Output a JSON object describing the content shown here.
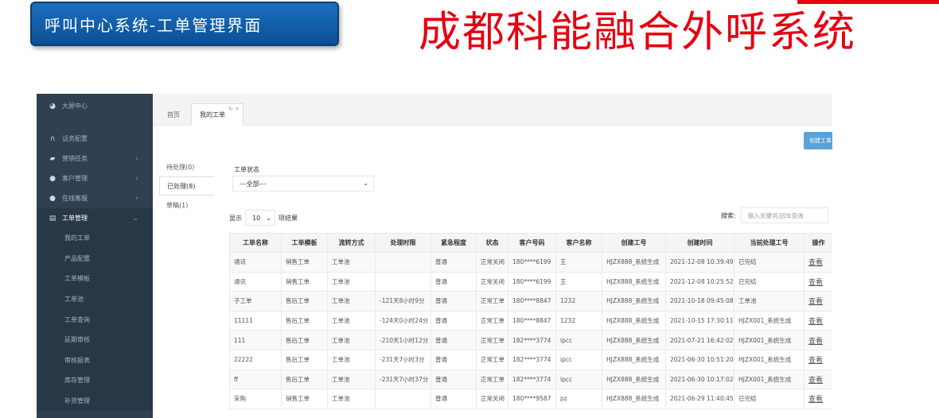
{
  "banner": {
    "left_title": "呼叫中心系统-工单管理界面",
    "brand_title": "成都科能融合外呼系统"
  },
  "sidebar": {
    "items": [
      {
        "icon": "pie-chart-icon",
        "label": "大屏中心",
        "has_arrow": false
      },
      {
        "icon": "headset-icon",
        "label": "话务配置",
        "has_arrow": false
      },
      {
        "icon": "briefcase-icon",
        "label": "营销任务",
        "has_arrow": true
      },
      {
        "icon": "user-icon",
        "label": "客户管理",
        "has_arrow": true
      },
      {
        "icon": "circle-icon",
        "label": "在线客服",
        "has_arrow": true
      },
      {
        "icon": "document-icon",
        "label": "工单管理",
        "has_arrow": true
      }
    ],
    "sub_items": [
      "我的工单",
      "产品配置",
      "工单模板",
      "工单池",
      "工单查询",
      "延期审核",
      "审核报表",
      "库存管理",
      "补货管理"
    ]
  },
  "tabs": {
    "home": "首页",
    "active": "我的工单"
  },
  "toolbar": {
    "create_label": "创建工单"
  },
  "left_nav": {
    "items": [
      "待处理(0)",
      "已处理(8)",
      "草稿(1)"
    ]
  },
  "filter": {
    "label": "工单状态",
    "value": "---全部---"
  },
  "paging": {
    "show_label": "显示",
    "page_size": "10",
    "suffix": "项结果"
  },
  "search": {
    "label": "搜索:",
    "placeholder": "输入关键词,回车查询"
  },
  "table": {
    "headers": [
      "工单名称",
      "工单模板",
      "流转方式",
      "处理时限",
      "紧急程度",
      "状态",
      "客户号码",
      "客户名称",
      "创建工号",
      "创建时间",
      "当前处理工号",
      "操作"
    ],
    "rows": [
      [
        "通讯",
        "销售工单",
        "工单池",
        "",
        "普通",
        "正常关闭",
        "180****6199",
        "王",
        "HJZX888_系统生成",
        "2021-12-08 10:39:49",
        "已完结",
        "查看"
      ],
      [
        "通讯",
        "销售工单",
        "工单池",
        "",
        "普通",
        "正常关闭",
        "180****6199",
        "王",
        "HJZX888_系统生成",
        "2021-12-08 10:25:52",
        "已完结",
        "查看"
      ],
      [
        "子工单",
        "售后工单",
        "工单池",
        "-121天8小时9分",
        "普通",
        "正常工单",
        "180****8847",
        "1232",
        "HJZX888_系统生成",
        "2021-10-18 09:45:08",
        "工单池",
        "查看"
      ],
      [
        "11111",
        "售后工单",
        "工单池",
        "-124天0小时24分",
        "普通",
        "正常工单",
        "180****8847",
        "1232",
        "HJZX888_系统生成",
        "2021-10-15 17:30:11",
        "HJZX001_系统生成",
        "查看"
      ],
      [
        "111",
        "售后工单",
        "工单池",
        "-210天1小时12分",
        "普通",
        "正常工单",
        "182****3774",
        "ipcc",
        "HJZX888_系统生成",
        "2021-07-21 16:42:02",
        "HJZX001_系统生成",
        "查看"
      ],
      [
        "22222",
        "售后工单",
        "工单池",
        "-231天7小时3分",
        "普通",
        "正常工单",
        "182****3774",
        "ipcc",
        "HJZX888_系统生成",
        "2021-06-30 10:51:20",
        "HJZX001_系统生成",
        "查看"
      ],
      [
        "ff",
        "售后工单",
        "工单池",
        "-231天7小时37分",
        "普通",
        "正常工单",
        "182****3774",
        "ipcc",
        "HJZX888_系统生成",
        "2021-06-30 10:17:02",
        "HJZX001_系统生成",
        "查看"
      ],
      [
        "采购",
        "销售工单",
        "工单池",
        "",
        "普通",
        "正常关闭",
        "180****9587",
        "pz",
        "HJZX888_系统生成",
        "2021-06-29 11:40:45",
        "已完结",
        "查看"
      ]
    ]
  },
  "colors": {
    "brand_red": "#e60012",
    "sidebar_bg": "#2f4050",
    "badge_blue": "#1b6fbf",
    "deadline_red": "#ed5565",
    "link_blue": "#337ab7"
  }
}
